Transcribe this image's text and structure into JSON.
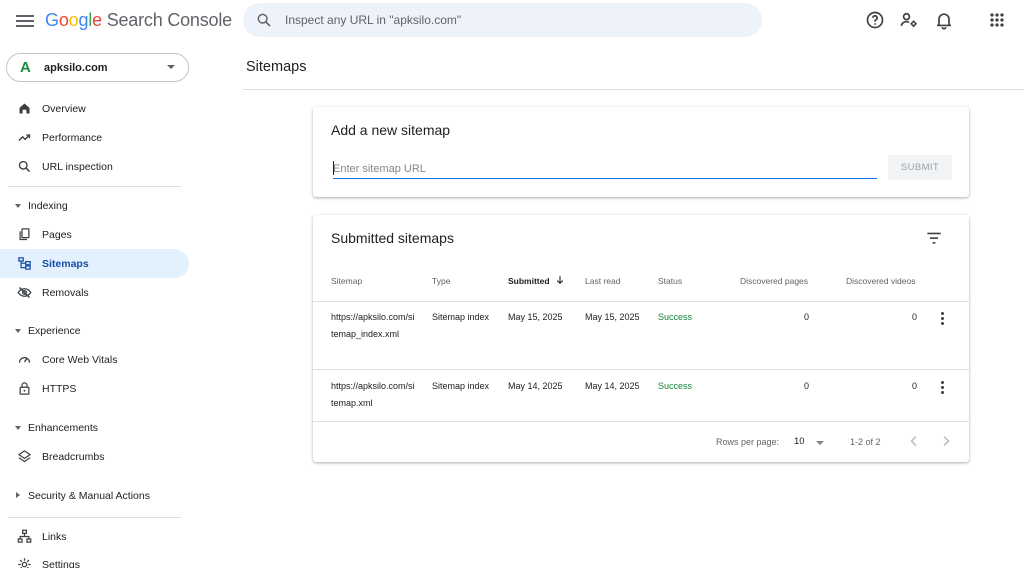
{
  "app": {
    "logo_letters": [
      "G",
      "o",
      "o",
      "g",
      "l",
      "e"
    ],
    "product": "Search Console",
    "search_placeholder": "Inspect any URL in \"apksilo.com\""
  },
  "top_icons": [
    "help-icon",
    "manage-users-icon",
    "notifications-icon",
    "apps-grid-icon"
  ],
  "property": {
    "name": "apksilo.com",
    "icon_letter": "A"
  },
  "nav": {
    "overview": "Overview",
    "performance": "Performance",
    "url_inspection": "URL inspection",
    "indexing": "Indexing",
    "pages": "Pages",
    "sitemaps": "Sitemaps",
    "removals": "Removals",
    "experience": "Experience",
    "core_web_vitals": "Core Web Vitals",
    "https": "HTTPS",
    "enhancements": "Enhancements",
    "breadcrumbs": "Breadcrumbs",
    "security": "Security & Manual Actions",
    "links": "Links",
    "settings": "Settings",
    "active": "Sitemaps"
  },
  "main": {
    "title": "Sitemaps",
    "add_card": {
      "heading": "Add a new sitemap",
      "input_placeholder": "Enter sitemap URL",
      "input_value": "",
      "submit_label": "SUBMIT"
    },
    "submitted_card": {
      "heading": "Submitted sitemaps",
      "columns": {
        "sitemap": "Sitemap",
        "type": "Type",
        "submitted": "Submitted",
        "last_read": "Last read",
        "status": "Status",
        "discovered_pages": "Discovered pages",
        "discovered_videos": "Discovered videos"
      },
      "sort_column": "Submitted",
      "rows": [
        {
          "sitemap": "https://apksilo.com/sitemap_index.xml",
          "type": "Sitemap index",
          "submitted": "May 15, 2025",
          "last_read": "May 15, 2025",
          "status": "Success",
          "discovered_pages": "0",
          "discovered_videos": "0"
        },
        {
          "sitemap": "https://apksilo.com/sitemap.xml",
          "type": "Sitemap index",
          "submitted": "May 14, 2025",
          "last_read": "May 14, 2025",
          "status": "Success",
          "discovered_pages": "0",
          "discovered_videos": "0"
        }
      ],
      "footer": {
        "rows_per_page_label": "Rows per page:",
        "rows_per_page_value": "10",
        "range": "1-2 of 2"
      }
    }
  },
  "colors": {
    "accent": "#1a73e8",
    "active_nav_bg": "#e3f0fd",
    "success": "#188038",
    "search_bg": "#eef3fb"
  }
}
